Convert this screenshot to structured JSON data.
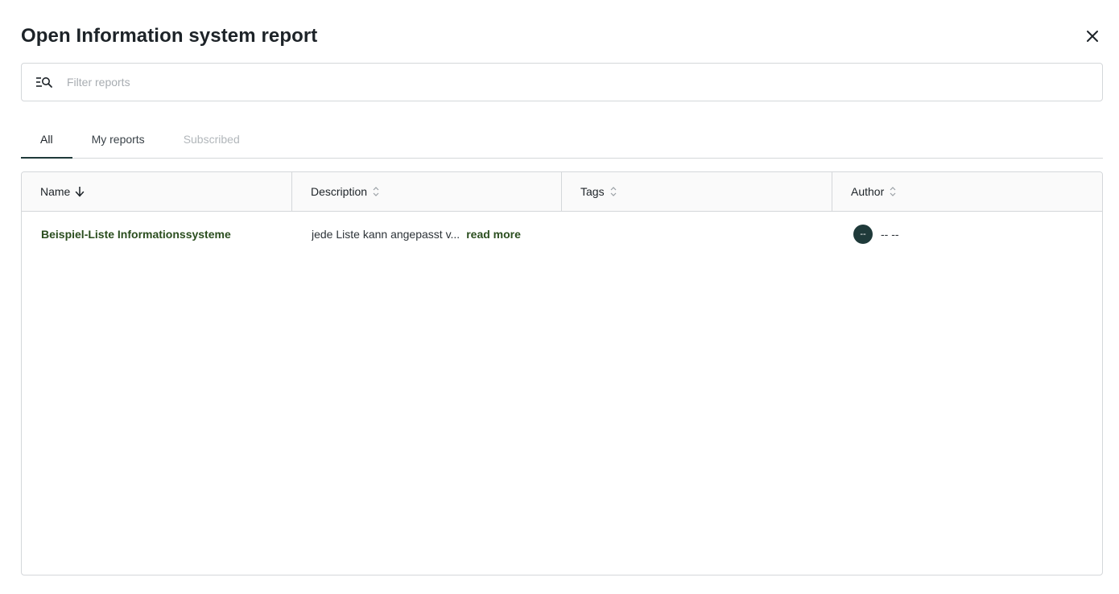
{
  "dialog": {
    "title": "Open Information system report",
    "close_icon": "close-icon"
  },
  "search": {
    "placeholder": "Filter reports",
    "value": "",
    "icon": "filter-search-icon"
  },
  "tabs": [
    {
      "label": "All",
      "active": true,
      "disabled": false
    },
    {
      "label": "My reports",
      "active": false,
      "disabled": false
    },
    {
      "label": "Subscribed",
      "active": false,
      "disabled": true
    }
  ],
  "table": {
    "columns": [
      {
        "label": "Name",
        "sort": "desc",
        "sort_icon": "arrow-down-icon"
      },
      {
        "label": "Description",
        "sort": "none",
        "sort_icon": "sort-icon"
      },
      {
        "label": "Tags",
        "sort": "none",
        "sort_icon": "sort-icon"
      },
      {
        "label": "Author",
        "sort": "none",
        "sort_icon": "sort-icon"
      }
    ],
    "rows": [
      {
        "name": "Beispiel-Liste Informationssysteme",
        "description": "jede Liste kann angepasst v...",
        "read_more": "read more",
        "tags": "",
        "author_initials": "--",
        "author_name": "-- --"
      }
    ]
  },
  "colors": {
    "accent": "#1f3a3a",
    "link": "#2a4d1e",
    "border": "#d4d7da"
  }
}
